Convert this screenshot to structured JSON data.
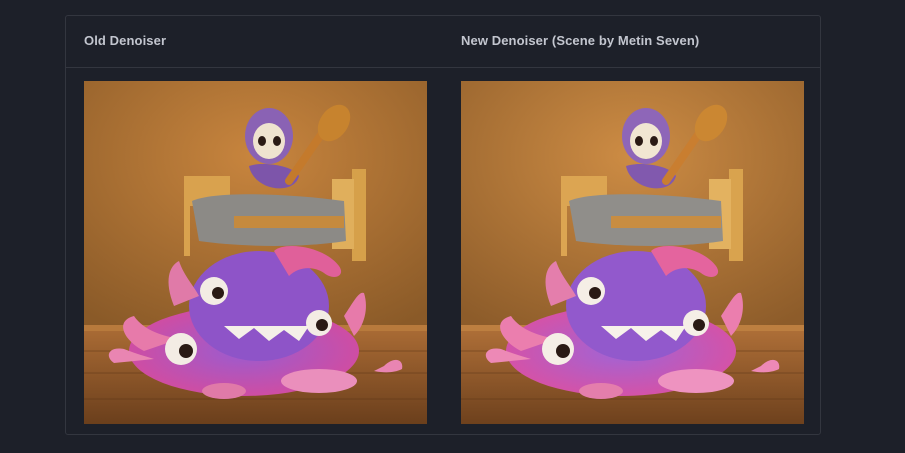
{
  "comparison": {
    "columns": [
      {
        "title": "Old Denoiser"
      },
      {
        "title": "New Denoiser (Scene by Metin Seven)"
      }
    ]
  },
  "colors": {
    "page_background": "#1d2029",
    "panel_border": "#33363f",
    "header_text": "#c3c6cf"
  },
  "images": [
    {
      "description_icon": "render-image-icon"
    },
    {
      "description_icon": "render-image-icon"
    }
  ]
}
